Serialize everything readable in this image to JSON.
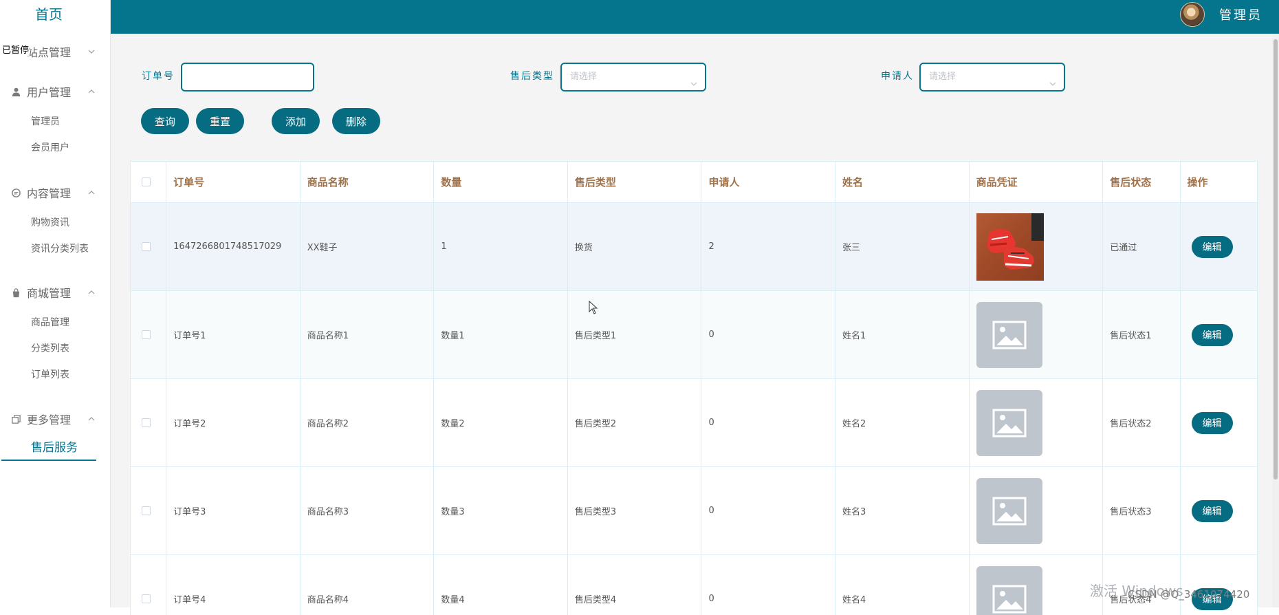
{
  "sidebar": {
    "home": "首页",
    "floating_label": "已暂停",
    "groups": [
      {
        "label": "站点管理",
        "icon": "site-icon",
        "expanded": false,
        "items": []
      },
      {
        "label": "用户管理",
        "icon": "user-icon",
        "expanded": true,
        "items": [
          "管理员",
          "会员用户"
        ]
      },
      {
        "label": "内容管理",
        "icon": "chat-icon",
        "expanded": true,
        "items": [
          "购物资讯",
          "资讯分类列表"
        ]
      },
      {
        "label": "商城管理",
        "icon": "bag-icon",
        "expanded": true,
        "items": [
          "商品管理",
          "分类列表",
          "订单列表"
        ]
      },
      {
        "label": "更多管理",
        "icon": "copy-icon",
        "expanded": true,
        "items": [
          "售后服务"
        ]
      }
    ],
    "active_item": "售后服务"
  },
  "topbar": {
    "admin_name": "管理员"
  },
  "filters": {
    "order_no_label": "订单号",
    "order_no_value": "",
    "type_label": "售后类型",
    "type_placeholder": "请选择",
    "applicant_label": "申请人",
    "applicant_placeholder": "请选择"
  },
  "actions": {
    "query": "查询",
    "reset": "重置",
    "add": "添加",
    "delete": "删除"
  },
  "table": {
    "columns": [
      "订单号",
      "商品名称",
      "数量",
      "售后类型",
      "申请人",
      "姓名",
      "商品凭证",
      "售后状态",
      "操作"
    ],
    "rows": [
      {
        "order_no": "1647266801748517029",
        "product": "XX鞋子",
        "qty": "1",
        "type": "换货",
        "applicant": "2",
        "name": "张三",
        "image": "photo",
        "status": "已通过",
        "action": "编辑"
      },
      {
        "order_no": "订单号1",
        "product": "商品名称1",
        "qty": "数量1",
        "type": "售后类型1",
        "applicant": "0",
        "name": "姓名1",
        "image": "placeholder",
        "status": "售后状态1",
        "action": "编辑"
      },
      {
        "order_no": "订单号2",
        "product": "商品名称2",
        "qty": "数量2",
        "type": "售后类型2",
        "applicant": "0",
        "name": "姓名2",
        "image": "placeholder",
        "status": "售后状态2",
        "action": "编辑"
      },
      {
        "order_no": "订单号3",
        "product": "商品名称3",
        "qty": "数量3",
        "type": "售后类型3",
        "applicant": "0",
        "name": "姓名3",
        "image": "placeholder",
        "status": "售后状态3",
        "action": "编辑"
      },
      {
        "order_no": "订单号4",
        "product": "商品名称4",
        "qty": "数量4",
        "type": "售后类型4",
        "applicant": "0",
        "name": "姓名4",
        "image": "placeholder",
        "status": "售后状态4",
        "action": "编辑"
      }
    ]
  },
  "overlay": {
    "watermark": "激活 Windows",
    "csdn": "CSDN @Q_3461074420"
  },
  "colors": {
    "accent": "#05758e",
    "header_text": "#a0724a"
  }
}
